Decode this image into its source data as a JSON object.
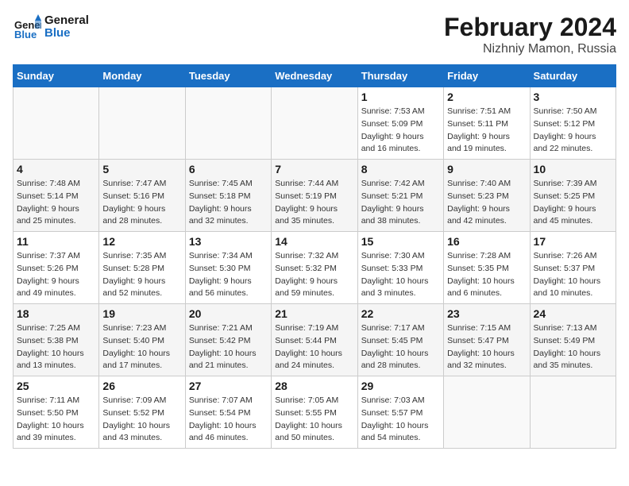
{
  "header": {
    "logo_text_general": "General",
    "logo_text_blue": "Blue",
    "month_year": "February 2024",
    "location": "Nizhniy Mamon, Russia"
  },
  "calendar": {
    "days_of_week": [
      "Sunday",
      "Monday",
      "Tuesday",
      "Wednesday",
      "Thursday",
      "Friday",
      "Saturday"
    ],
    "weeks": [
      [
        {
          "day": "",
          "info": ""
        },
        {
          "day": "",
          "info": ""
        },
        {
          "day": "",
          "info": ""
        },
        {
          "day": "",
          "info": ""
        },
        {
          "day": "1",
          "info": "Sunrise: 7:53 AM\nSunset: 5:09 PM\nDaylight: 9 hours\nand 16 minutes."
        },
        {
          "day": "2",
          "info": "Sunrise: 7:51 AM\nSunset: 5:11 PM\nDaylight: 9 hours\nand 19 minutes."
        },
        {
          "day": "3",
          "info": "Sunrise: 7:50 AM\nSunset: 5:12 PM\nDaylight: 9 hours\nand 22 minutes."
        }
      ],
      [
        {
          "day": "4",
          "info": "Sunrise: 7:48 AM\nSunset: 5:14 PM\nDaylight: 9 hours\nand 25 minutes."
        },
        {
          "day": "5",
          "info": "Sunrise: 7:47 AM\nSunset: 5:16 PM\nDaylight: 9 hours\nand 28 minutes."
        },
        {
          "day": "6",
          "info": "Sunrise: 7:45 AM\nSunset: 5:18 PM\nDaylight: 9 hours\nand 32 minutes."
        },
        {
          "day": "7",
          "info": "Sunrise: 7:44 AM\nSunset: 5:19 PM\nDaylight: 9 hours\nand 35 minutes."
        },
        {
          "day": "8",
          "info": "Sunrise: 7:42 AM\nSunset: 5:21 PM\nDaylight: 9 hours\nand 38 minutes."
        },
        {
          "day": "9",
          "info": "Sunrise: 7:40 AM\nSunset: 5:23 PM\nDaylight: 9 hours\nand 42 minutes."
        },
        {
          "day": "10",
          "info": "Sunrise: 7:39 AM\nSunset: 5:25 PM\nDaylight: 9 hours\nand 45 minutes."
        }
      ],
      [
        {
          "day": "11",
          "info": "Sunrise: 7:37 AM\nSunset: 5:26 PM\nDaylight: 9 hours\nand 49 minutes."
        },
        {
          "day": "12",
          "info": "Sunrise: 7:35 AM\nSunset: 5:28 PM\nDaylight: 9 hours\nand 52 minutes."
        },
        {
          "day": "13",
          "info": "Sunrise: 7:34 AM\nSunset: 5:30 PM\nDaylight: 9 hours\nand 56 minutes."
        },
        {
          "day": "14",
          "info": "Sunrise: 7:32 AM\nSunset: 5:32 PM\nDaylight: 9 hours\nand 59 minutes."
        },
        {
          "day": "15",
          "info": "Sunrise: 7:30 AM\nSunset: 5:33 PM\nDaylight: 10 hours\nand 3 minutes."
        },
        {
          "day": "16",
          "info": "Sunrise: 7:28 AM\nSunset: 5:35 PM\nDaylight: 10 hours\nand 6 minutes."
        },
        {
          "day": "17",
          "info": "Sunrise: 7:26 AM\nSunset: 5:37 PM\nDaylight: 10 hours\nand 10 minutes."
        }
      ],
      [
        {
          "day": "18",
          "info": "Sunrise: 7:25 AM\nSunset: 5:38 PM\nDaylight: 10 hours\nand 13 minutes."
        },
        {
          "day": "19",
          "info": "Sunrise: 7:23 AM\nSunset: 5:40 PM\nDaylight: 10 hours\nand 17 minutes."
        },
        {
          "day": "20",
          "info": "Sunrise: 7:21 AM\nSunset: 5:42 PM\nDaylight: 10 hours\nand 21 minutes."
        },
        {
          "day": "21",
          "info": "Sunrise: 7:19 AM\nSunset: 5:44 PM\nDaylight: 10 hours\nand 24 minutes."
        },
        {
          "day": "22",
          "info": "Sunrise: 7:17 AM\nSunset: 5:45 PM\nDaylight: 10 hours\nand 28 minutes."
        },
        {
          "day": "23",
          "info": "Sunrise: 7:15 AM\nSunset: 5:47 PM\nDaylight: 10 hours\nand 32 minutes."
        },
        {
          "day": "24",
          "info": "Sunrise: 7:13 AM\nSunset: 5:49 PM\nDaylight: 10 hours\nand 35 minutes."
        }
      ],
      [
        {
          "day": "25",
          "info": "Sunrise: 7:11 AM\nSunset: 5:50 PM\nDaylight: 10 hours\nand 39 minutes."
        },
        {
          "day": "26",
          "info": "Sunrise: 7:09 AM\nSunset: 5:52 PM\nDaylight: 10 hours\nand 43 minutes."
        },
        {
          "day": "27",
          "info": "Sunrise: 7:07 AM\nSunset: 5:54 PM\nDaylight: 10 hours\nand 46 minutes."
        },
        {
          "day": "28",
          "info": "Sunrise: 7:05 AM\nSunset: 5:55 PM\nDaylight: 10 hours\nand 50 minutes."
        },
        {
          "day": "29",
          "info": "Sunrise: 7:03 AM\nSunset: 5:57 PM\nDaylight: 10 hours\nand 54 minutes."
        },
        {
          "day": "",
          "info": ""
        },
        {
          "day": "",
          "info": ""
        }
      ]
    ]
  }
}
